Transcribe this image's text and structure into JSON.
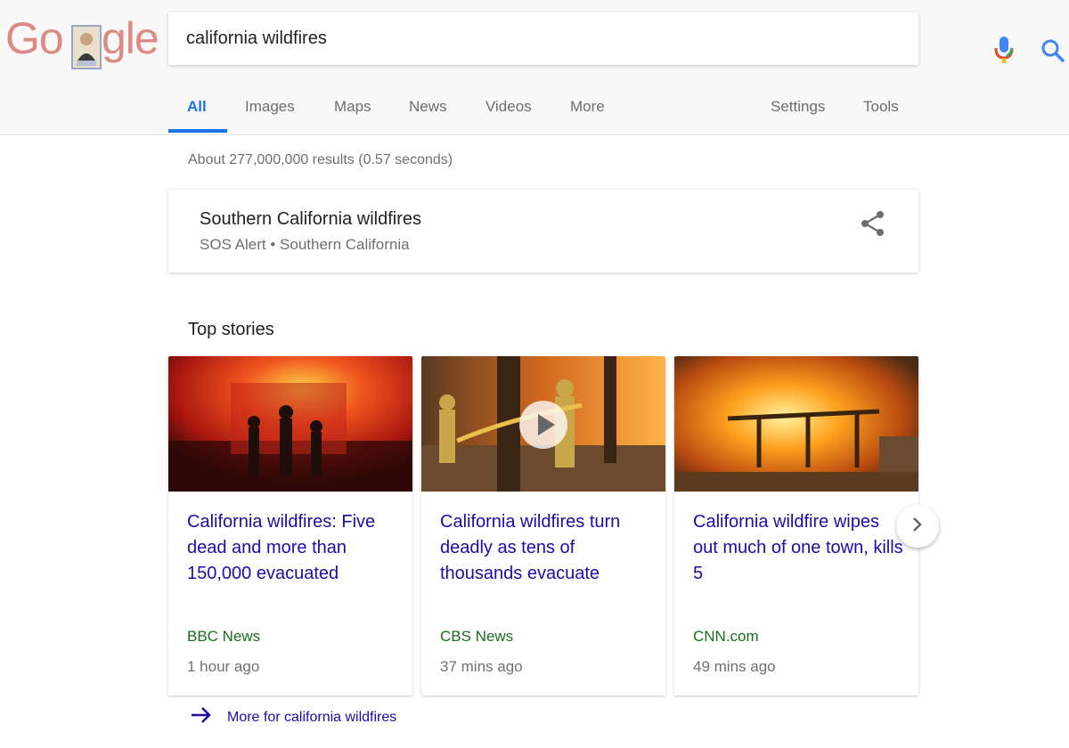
{
  "logo": {
    "letters_left": "Go",
    "letters_right": "gle"
  },
  "search": {
    "query": "california wildfires"
  },
  "tabs": [
    {
      "label": "All",
      "active": true
    },
    {
      "label": "Images",
      "active": false
    },
    {
      "label": "Maps",
      "active": false
    },
    {
      "label": "News",
      "active": false
    },
    {
      "label": "Videos",
      "active": false
    },
    {
      "label": "More",
      "active": false
    },
    {
      "label": "Settings",
      "active": false
    },
    {
      "label": "Tools",
      "active": false
    }
  ],
  "results": {
    "stats": "About 277,000,000 results (0.57 seconds)"
  },
  "sos": {
    "title": "Southern California wildfires",
    "subtitle": "SOS Alert • Southern California"
  },
  "top_stories": {
    "title": "Top stories",
    "stories": [
      {
        "title": "California wildfires: Five dead and more than 150,000 evacuated",
        "source": "BBC News",
        "time": "1 hour ago",
        "has_video": false
      },
      {
        "title": "California wildfires turn deadly as tens of thousands evacuate",
        "source": "CBS News",
        "time": "37 mins ago",
        "has_video": true
      },
      {
        "title": "California wildfire wipes out much of one town, kills 5",
        "source": "CNN.com",
        "time": "49 mins ago",
        "has_video": false
      }
    ],
    "more_link": "More for california wildfires"
  },
  "colors": {
    "accent_blue": "#1a73e8",
    "link_blue": "#1a0dab",
    "source_green": "#1a6b1f",
    "mic_colors": [
      "#4285f4",
      "#ea4335",
      "#fbbc05",
      "#34a853"
    ]
  },
  "icons": {
    "mic": "mic-icon",
    "search": "search-icon",
    "share": "share-icon",
    "next": "chevron-right-icon",
    "more_arrow": "arrow-right-icon",
    "play": "play-icon"
  }
}
